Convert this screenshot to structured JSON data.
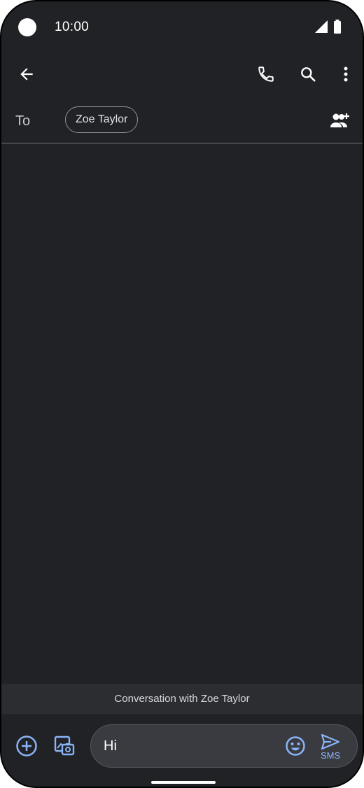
{
  "status_bar": {
    "time": "10:00",
    "icons": [
      "signal-icon",
      "battery-icon"
    ]
  },
  "toolbar": {
    "icons": [
      "back-arrow-icon",
      "phone-icon",
      "search-icon",
      "more-vert-icon"
    ]
  },
  "recipient": {
    "to_label": "To",
    "chip_name": "Zoe Taylor",
    "add_icon": "add-person-icon"
  },
  "banner": {
    "text": "Conversation with Zoe Taylor"
  },
  "compose": {
    "text_value": "Hi",
    "send_label": "SMS",
    "icons": [
      "add-circle-icon",
      "gallery-icon",
      "emoji-icon",
      "send-icon"
    ]
  },
  "colors": {
    "background": "#212226",
    "accent": "#8ab4f8"
  }
}
